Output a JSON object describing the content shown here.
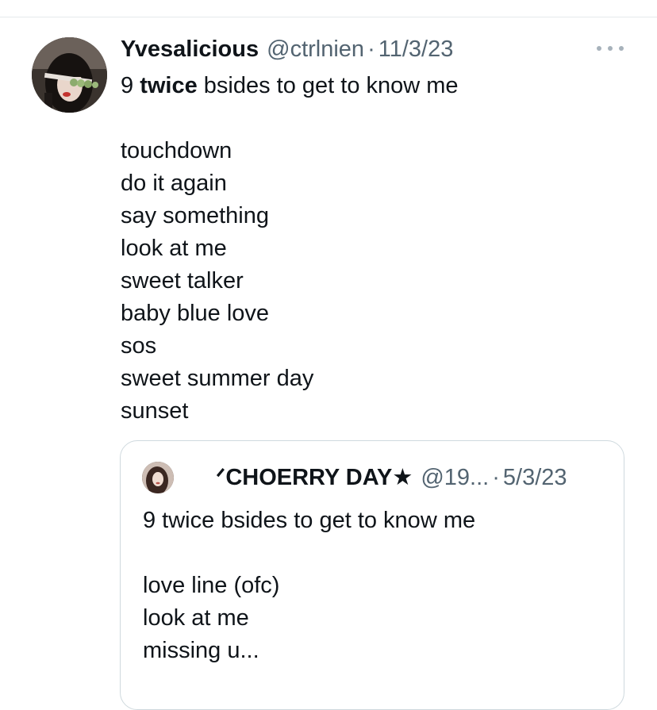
{
  "tweet": {
    "display_name": "Yvesalicious",
    "handle": "@ctrlnien",
    "separator": "·",
    "date": "11/3/23",
    "text_prefix": "9 ",
    "text_bold": "twice",
    "text_suffix": " bsides to get to know me",
    "songs": [
      "touchdown",
      "do it again",
      "say something",
      "look at me",
      "sweet talker",
      "baby blue love",
      "sos",
      "sweet summer day",
      "sunset"
    ],
    "more_icon": "more-horizontal-icon",
    "avatar_icon": "profile-avatar"
  },
  "quote": {
    "display_name": "ᐟCHOERRY DAY★",
    "handle": "@19...",
    "separator": "·",
    "date": "5/3/23",
    "text_first_line": "9 twice bsides to get to know me",
    "songs": [
      "love line (ofc)",
      "look at me",
      "missing u..."
    ],
    "avatar_icon": "profile-avatar"
  },
  "colors": {
    "text_primary": "#0f1419",
    "text_secondary": "#536471",
    "border": "#cfd9de",
    "divider": "#e6e9ec",
    "more_dots": "#a7b2bb"
  }
}
